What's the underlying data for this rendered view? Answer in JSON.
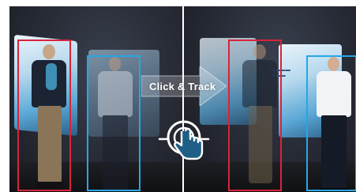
{
  "overlay": {
    "action_label": "Click & Track"
  },
  "icons": {
    "arrow": "right-arrow-icon",
    "click": "tap-hand-icon"
  },
  "colors": {
    "red_box": "#d8243a",
    "blue_box": "#25a7e6",
    "arrow": "#ffffff"
  }
}
